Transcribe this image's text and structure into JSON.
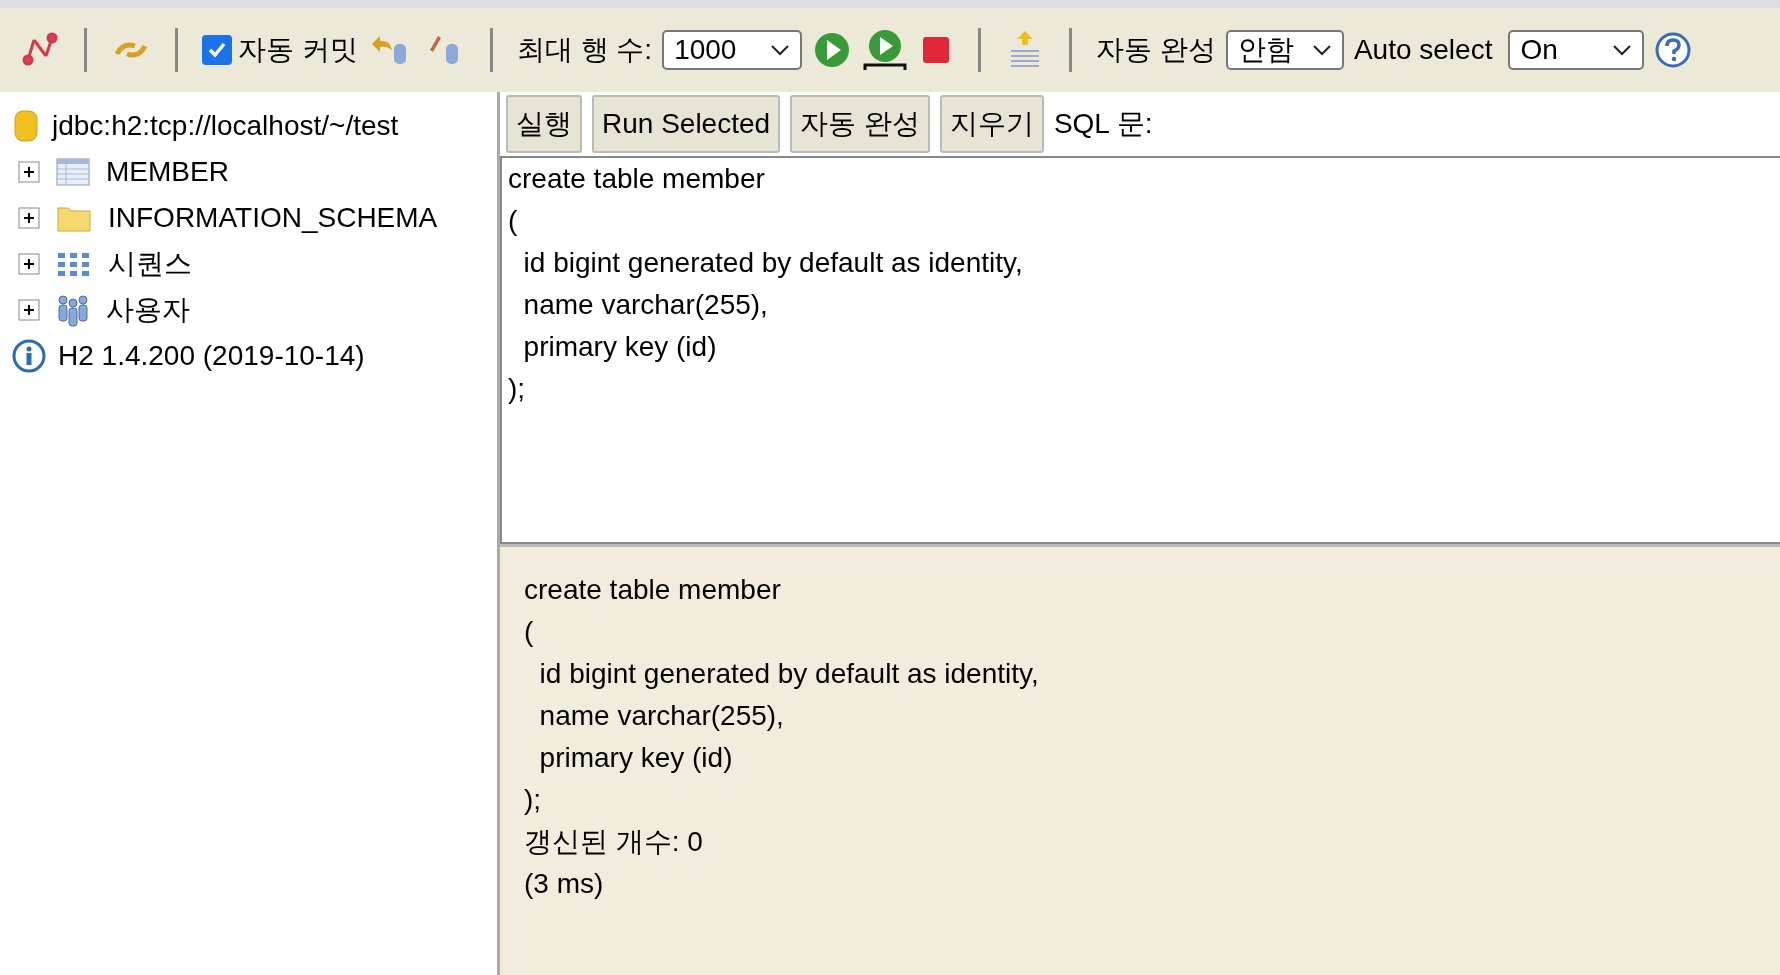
{
  "toolbar": {
    "auto_commit": {
      "label": "자동 커밋",
      "checked": true
    },
    "max_rows": {
      "label": "최대 행 수:",
      "value": "1000"
    },
    "autocomplete": {
      "label": "자동 완성",
      "value": "안함"
    },
    "auto_select": {
      "label": "Auto select",
      "value": "On"
    }
  },
  "tree": {
    "connection": "jdbc:h2:tcp://localhost/~/test",
    "items": [
      {
        "label": "MEMBER",
        "kind": "table",
        "expanded": false
      },
      {
        "label": "INFORMATION_SCHEMA",
        "kind": "folder",
        "expanded": false
      },
      {
        "label": "시퀀스",
        "kind": "sequence",
        "expanded": false
      },
      {
        "label": "사용자",
        "kind": "users",
        "expanded": false
      }
    ],
    "version": "H2 1.4.200 (2019-10-14)"
  },
  "query": {
    "buttons": [
      "실행",
      "Run Selected",
      "자동 완성",
      "지우기"
    ],
    "sql_label": "SQL 문:",
    "editor_lines": [
      "create table member",
      "(",
      "  id bigint generated by default as identity,",
      "  name varchar(255),",
      "  primary key (id)",
      ");"
    ]
  },
  "result": {
    "lines": [
      "create table member",
      "(",
      "  id bigint generated by default as identity,",
      "  name varchar(255),",
      "  primary key (id)",
      ");",
      "갱신된 개수: 0",
      "(3 ms)"
    ]
  }
}
